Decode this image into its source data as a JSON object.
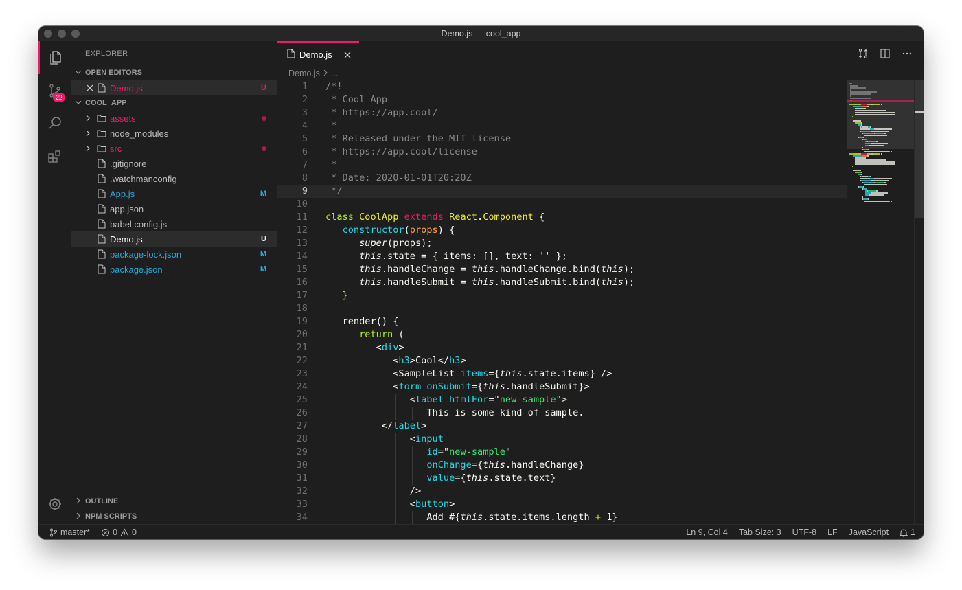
{
  "window": {
    "title": "Demo.js — cool_app"
  },
  "activity": {
    "scm_badge": "22"
  },
  "sidebar": {
    "title": "EXPLORER",
    "open_editors_label": "OPEN EDITORS",
    "open_editors": [
      {
        "name": "Demo.js",
        "status": "U"
      }
    ],
    "project_label": "COOL_APP",
    "tree": [
      {
        "name": "assets",
        "kind": "folder",
        "status": "dot",
        "color": "#f4186d"
      },
      {
        "name": "node_modules",
        "kind": "folder",
        "status": "",
        "color": "#bbbbbb"
      },
      {
        "name": "src",
        "kind": "folder",
        "status": "dot",
        "color": "#f4186d"
      },
      {
        "name": ".gitignore",
        "kind": "file",
        "status": "",
        "color": "#bbbbbb"
      },
      {
        "name": ".watchmanconfig",
        "kind": "file",
        "status": "",
        "color": "#bbbbbb"
      },
      {
        "name": "App.js",
        "kind": "file",
        "status": "M",
        "color": "#28a7d8"
      },
      {
        "name": "app.json",
        "kind": "file",
        "status": "",
        "color": "#bbbbbb"
      },
      {
        "name": "babel.config.js",
        "kind": "file",
        "status": "",
        "color": "#bbbbbb"
      },
      {
        "name": "Demo.js",
        "kind": "file",
        "status": "U",
        "color": "#ffffff",
        "selected": true
      },
      {
        "name": "package-lock.json",
        "kind": "file",
        "status": "M",
        "color": "#28a7d8"
      },
      {
        "name": "package.json",
        "kind": "file",
        "status": "M",
        "color": "#28a7d8"
      }
    ],
    "outline_label": "OUTLINE",
    "npm_label": "NPM SCRIPTS"
  },
  "editor": {
    "tab_label": "Demo.js",
    "breadcrumb": [
      "Demo.js",
      "..."
    ],
    "current_line": 9,
    "lines": [
      [
        [
          "/*!",
          "cm"
        ]
      ],
      [
        [
          " * Cool App",
          "cm"
        ]
      ],
      [
        [
          " * https://app.cool/",
          "cm"
        ]
      ],
      [
        [
          " *",
          "cm"
        ]
      ],
      [
        [
          " * Released under the MIT license",
          "cm"
        ]
      ],
      [
        [
          " * https://app.cool/license",
          "cm"
        ]
      ],
      [
        [
          " *",
          "cm"
        ]
      ],
      [
        [
          " * Date: 2020-01-01T20:20Z",
          "cm"
        ]
      ],
      [
        [
          " */",
          "cm"
        ]
      ],
      [],
      [
        [
          "class ",
          "gr"
        ],
        [
          "CoolApp ",
          "yl"
        ],
        [
          "extends ",
          "pk"
        ],
        [
          "React",
          "yl"
        ],
        [
          ".",
          "wh"
        ],
        [
          "Component",
          "yl"
        ],
        [
          " {",
          "wh"
        ]
      ],
      [
        [
          "   ",
          "wh"
        ],
        [
          "constructor",
          "cy"
        ],
        [
          "(",
          "wh"
        ],
        [
          "props",
          "or"
        ],
        [
          ") {",
          "wh"
        ]
      ],
      [
        [
          "      ",
          "wh"
        ],
        [
          "super",
          "it"
        ],
        [
          "(props);",
          "wh"
        ]
      ],
      [
        [
          "      ",
          "wh"
        ],
        [
          "this",
          "it"
        ],
        [
          ".state = { items: [], text: '' };",
          "wh"
        ]
      ],
      [
        [
          "      ",
          "wh"
        ],
        [
          "this",
          "it"
        ],
        [
          ".handleChange = ",
          "wh"
        ],
        [
          "this",
          "it"
        ],
        [
          ".handleChange.bind(",
          "wh"
        ],
        [
          "this",
          "it"
        ],
        [
          ");",
          "wh"
        ]
      ],
      [
        [
          "      ",
          "wh"
        ],
        [
          "this",
          "it"
        ],
        [
          ".handleSubmit = ",
          "wh"
        ],
        [
          "this",
          "it"
        ],
        [
          ".handleSubmit.bind(",
          "wh"
        ],
        [
          "this",
          "it"
        ],
        [
          ");",
          "wh"
        ]
      ],
      [
        [
          "   }",
          "gr"
        ]
      ],
      [],
      [
        [
          "   ",
          "wh"
        ],
        [
          "render",
          "wh"
        ],
        [
          "() {",
          "wh"
        ]
      ],
      [
        [
          "      ",
          "wh"
        ],
        [
          "return ",
          "gr"
        ],
        [
          "(",
          "wh"
        ]
      ],
      [
        [
          "         ",
          "wh"
        ],
        [
          "<",
          "wh"
        ],
        [
          "div",
          "cy"
        ],
        [
          ">",
          "wh"
        ]
      ],
      [
        [
          "            ",
          "wh"
        ],
        [
          "<",
          "wh"
        ],
        [
          "h3",
          "cy"
        ],
        [
          ">Cool</",
          "wh"
        ],
        [
          "h3",
          "cy"
        ],
        [
          ">",
          "wh"
        ]
      ],
      [
        [
          "            ",
          "wh"
        ],
        [
          "<SampleList ",
          "wh"
        ],
        [
          "items",
          "cy"
        ],
        [
          "={",
          "wh"
        ],
        [
          "this",
          "it"
        ],
        [
          ".state.items} />",
          "wh"
        ]
      ],
      [
        [
          "            ",
          "wh"
        ],
        [
          "<",
          "wh"
        ],
        [
          "form ",
          "cy"
        ],
        [
          "onSubmit",
          "cy"
        ],
        [
          "={",
          "wh"
        ],
        [
          "this",
          "it"
        ],
        [
          ".handleSubmit}>",
          "wh"
        ]
      ],
      [
        [
          "               ",
          "wh"
        ],
        [
          "<",
          "wh"
        ],
        [
          "label ",
          "cy"
        ],
        [
          "htmlFor",
          "cy"
        ],
        [
          "=\"",
          "wh"
        ],
        [
          "new-sample",
          "gn"
        ],
        [
          "\">",
          "wh"
        ]
      ],
      [
        [
          "                  This is some kind of sample.",
          "wh"
        ]
      ],
      [
        [
          "          </",
          "wh"
        ],
        [
          "label",
          "cy"
        ],
        [
          ">",
          "wh"
        ]
      ],
      [
        [
          "               ",
          "wh"
        ],
        [
          "<",
          "wh"
        ],
        [
          "input",
          "cy"
        ]
      ],
      [
        [
          "                  ",
          "wh"
        ],
        [
          "id",
          "cy"
        ],
        [
          "=\"",
          "wh"
        ],
        [
          "new-sample",
          "gn"
        ],
        [
          "\"",
          "wh"
        ]
      ],
      [
        [
          "                  ",
          "wh"
        ],
        [
          "onChange",
          "cy"
        ],
        [
          "={",
          "wh"
        ],
        [
          "this",
          "it"
        ],
        [
          ".handleChange}",
          "wh"
        ]
      ],
      [
        [
          "                  ",
          "wh"
        ],
        [
          "value",
          "cy"
        ],
        [
          "={",
          "wh"
        ],
        [
          "this",
          "it"
        ],
        [
          ".state.text}",
          "wh"
        ]
      ],
      [
        [
          "               />",
          "wh"
        ]
      ],
      [
        [
          "               ",
          "wh"
        ],
        [
          "<",
          "wh"
        ],
        [
          "button",
          "cy"
        ],
        [
          ">",
          "wh"
        ]
      ],
      [
        [
          "                  Add #{",
          "wh"
        ],
        [
          "this",
          "it"
        ],
        [
          ".state.items.length ",
          "wh"
        ],
        [
          "+",
          "gr"
        ],
        [
          " 1}",
          "wh"
        ]
      ]
    ]
  },
  "status": {
    "branch": "master*",
    "errors": "0",
    "warnings": "0",
    "position": "Ln 9, Col 4",
    "tab_size": "Tab Size: 3",
    "encoding": "UTF-8",
    "eol": "LF",
    "language": "JavaScript",
    "notifications": "1"
  },
  "colors": {
    "accent": "#f4186d",
    "modified": "#28a7d8",
    "untracked": "#f4186d",
    "syntax": {
      "cm": "#8a8a8a",
      "wh": "#f8f8f2",
      "gr": "#b4f515",
      "yl": "#eded2c",
      "pk": "#f4186d",
      "cy": "#22d9e6",
      "or": "#ffa033",
      "gn": "#35e66d",
      "it": "#f8f8f2"
    }
  }
}
